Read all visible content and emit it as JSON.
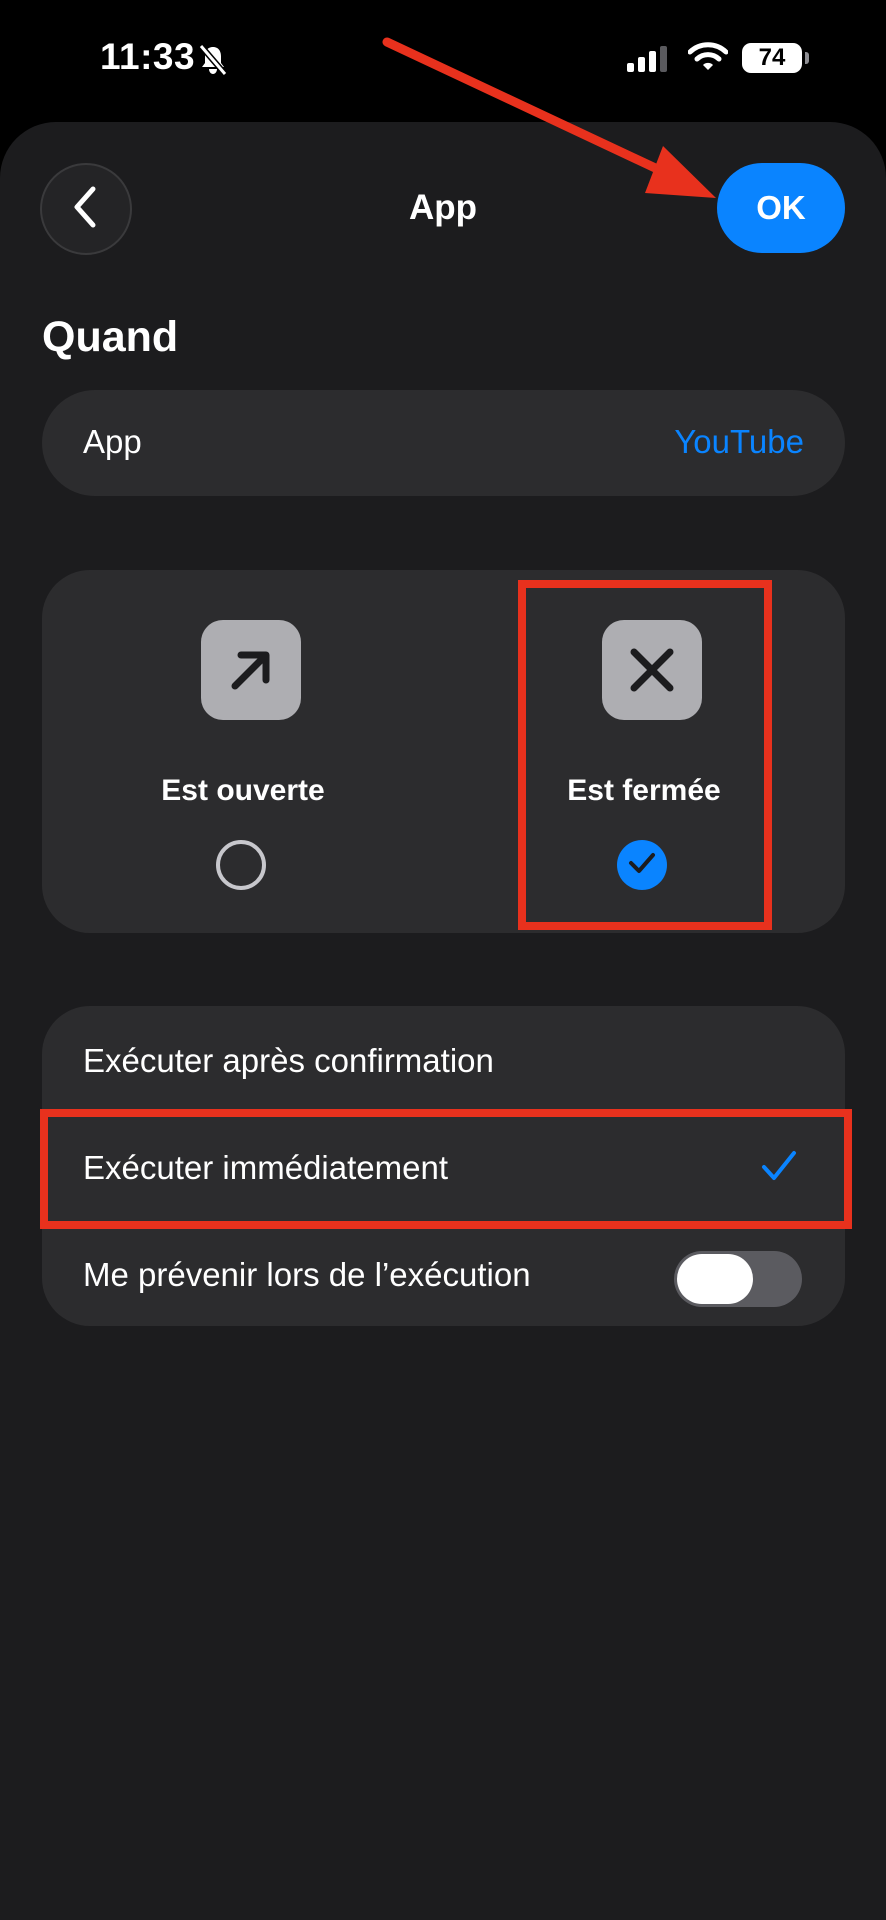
{
  "status_bar": {
    "time": "11:33",
    "battery_level": "74",
    "icons": [
      "bell-slash-icon",
      "cellular-signal-icon",
      "wifi-icon",
      "battery-icon"
    ]
  },
  "header": {
    "title": "App",
    "ok_label": "OK",
    "back_icon": "chevron-left-icon"
  },
  "section": {
    "heading": "Quand"
  },
  "app_row": {
    "label": "App",
    "value": "YouTube"
  },
  "trigger_options": [
    {
      "label": "Est ouverte",
      "icon": "arrow-up-right-icon",
      "selected": false
    },
    {
      "label": "Est fermée",
      "icon": "xmark-icon",
      "selected": true
    }
  ],
  "execution_options": [
    {
      "label": "Exécuter après confirmation",
      "selected": false
    },
    {
      "label": "Exécuter immédiatement",
      "selected": true
    }
  ],
  "notify_row": {
    "label": "Me prévenir lors de l’exécution",
    "toggle_on": false
  },
  "colors": {
    "accent": "#0a84ff",
    "sheet_background": "#1c1c1e",
    "card_background": "#2c2c2e",
    "annotation_red": "#e8311d"
  }
}
